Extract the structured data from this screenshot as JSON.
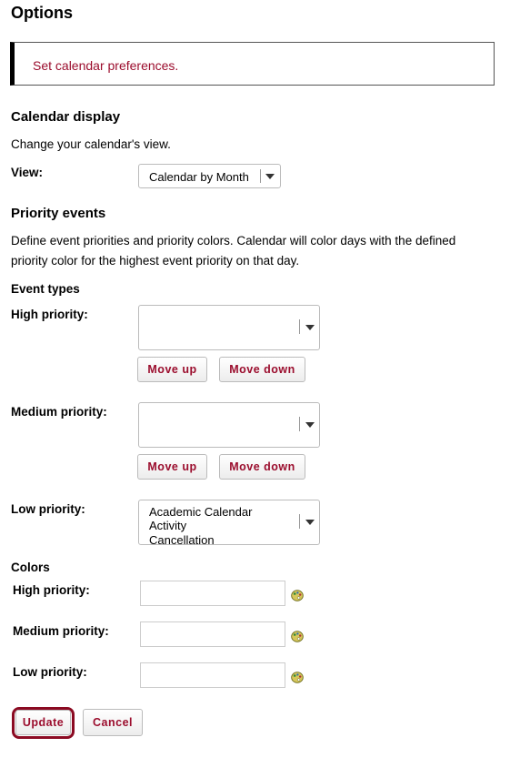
{
  "page": {
    "title": "Options"
  },
  "message": {
    "text": "Set calendar preferences."
  },
  "calendar_display": {
    "heading": "Calendar display",
    "description": "Change your calendar's view.",
    "view_label": "View:",
    "view_selected": "Calendar by Month"
  },
  "priority_events": {
    "heading": "Priority events",
    "description_line1": "Define event priorities and priority colors. Calendar will color days with the defined",
    "description_line2": "priority color for the highest event priority on that day.",
    "event_types_heading": "Event types",
    "high": {
      "label": "High priority:",
      "move_up": "Move up",
      "move_down": "Move down",
      "items": []
    },
    "medium": {
      "label": "Medium priority:",
      "move_up": "Move up",
      "move_down": "Move down",
      "items": []
    },
    "low": {
      "label": "Low priority:",
      "items": [
        "Academic Calendar",
        "Activity",
        "Cancellation"
      ]
    }
  },
  "colors": {
    "heading": "Colors",
    "high_label": "High priority:",
    "medium_label": "Medium priority:",
    "low_label": "Low priority:",
    "high_value": "",
    "medium_value": "",
    "low_value": "",
    "picker_icon": "palette-icon"
  },
  "actions": {
    "update": "Update",
    "cancel": "Cancel"
  },
  "theme": {
    "accent": "#9b0d2d",
    "highlight_ring": "#8b0a22"
  }
}
